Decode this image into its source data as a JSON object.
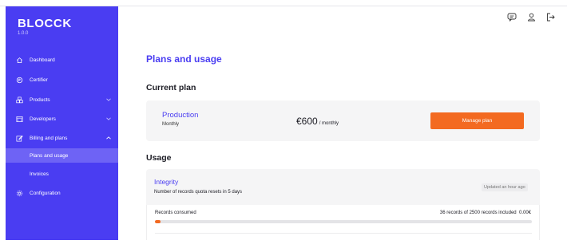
{
  "app": {
    "brand": "BLOCCK",
    "version": "1.0.0"
  },
  "sidebar": {
    "items": [
      {
        "label": "Dashboard",
        "icon": "home-icon"
      },
      {
        "label": "Certifier",
        "icon": "certificate-icon"
      },
      {
        "label": "Products",
        "icon": "boxes-icon",
        "chevron": "down"
      },
      {
        "label": "Developers",
        "icon": "code-icon",
        "chevron": "down"
      },
      {
        "label": "Billing and plans",
        "icon": "edit-icon",
        "chevron": "up"
      },
      {
        "label": "Configuration",
        "icon": "gear-icon"
      }
    ],
    "sub_items": [
      {
        "label": "Plans and usage",
        "active": true
      },
      {
        "label": "Invoices",
        "active": false
      }
    ]
  },
  "header": {
    "icons": [
      "chat-icon",
      "user-icon",
      "logout-icon"
    ]
  },
  "main": {
    "title": "Plans and usage",
    "current_plan": {
      "heading": "Current plan",
      "name": "Production",
      "period": "Monthly",
      "price": "€600",
      "price_unit": "/ monthly",
      "button_label": "Manage plan"
    },
    "usage": {
      "heading": "Usage",
      "name": "Integrity",
      "description": "Number of records quota resets in 5 days",
      "updated": "Updated an hour ago",
      "records_label": "Records consumed",
      "records_summary": "36 records of 2500 records included",
      "cost": "0.00€",
      "progress_fraction": 0.0144
    }
  },
  "colors": {
    "brand": "#4a3df2",
    "accent": "#f36a21",
    "active_sub": "#6e63f5"
  }
}
